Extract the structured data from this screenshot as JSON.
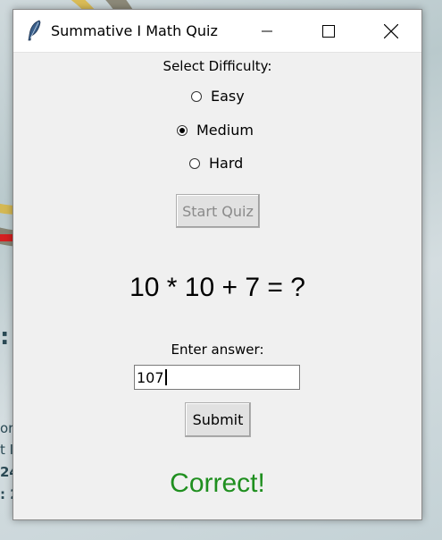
{
  "window": {
    "title": "Summative I Math Quiz",
    "icon": "feather-icon"
  },
  "difficulty": {
    "label": "Select Difficulty:",
    "options": [
      {
        "label": "Easy",
        "selected": false
      },
      {
        "label": "Medium",
        "selected": true
      },
      {
        "label": "Hard",
        "selected": false
      }
    ]
  },
  "start_button": {
    "label": "Start Quiz",
    "enabled": false
  },
  "question": {
    "text": "10 * 10 + 7 = ?"
  },
  "answer": {
    "label": "Enter answer:",
    "value": "107"
  },
  "submit_button": {
    "label": "Submit"
  },
  "result": {
    "text": "Correct!",
    "color": "#1f8f1f"
  },
  "desktop": {
    "text_fragments": [
      ":",
      "or",
      "t I",
      "24",
      ": 2"
    ]
  }
}
